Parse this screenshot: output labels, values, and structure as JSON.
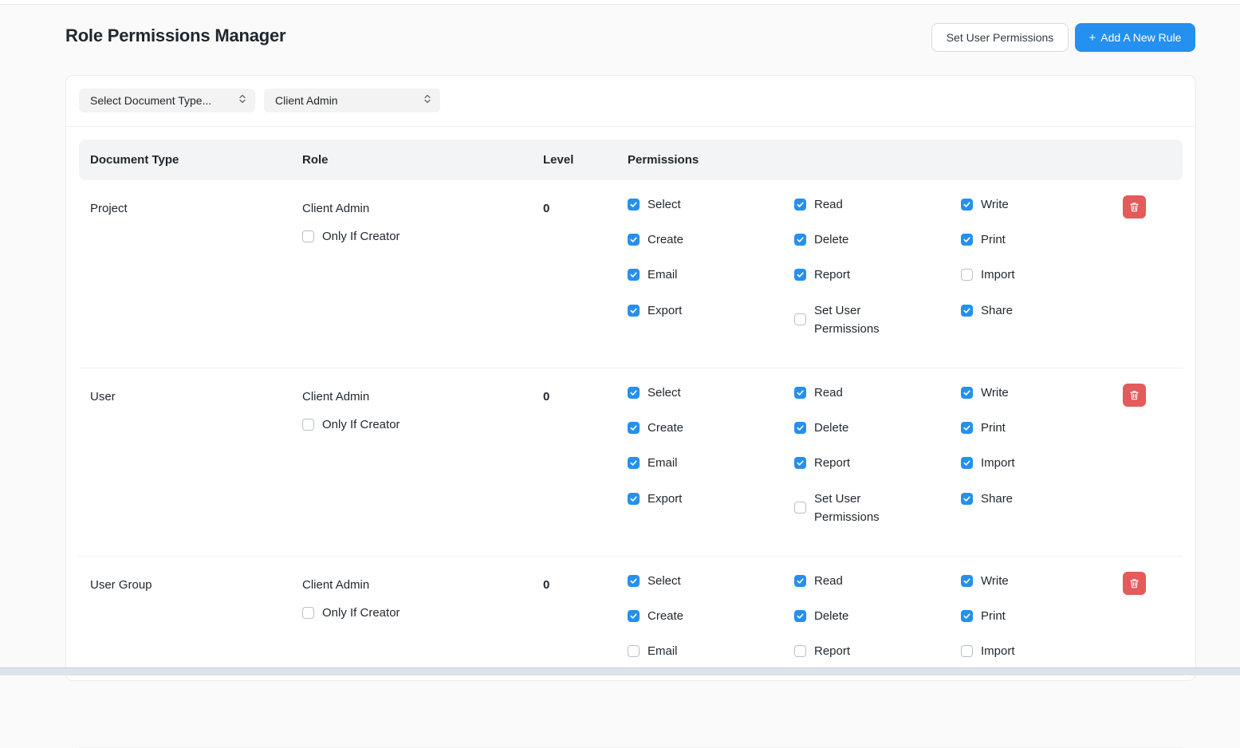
{
  "page": {
    "title": "Role Permissions Manager",
    "set_user_permissions_button": "Set User Permissions",
    "add_rule_button": "Add A New Rule",
    "add_rule_icon": "+"
  },
  "filters": {
    "document_type": "Select Document Type...",
    "role": "Client Admin"
  },
  "table": {
    "headers": {
      "document_type": "Document Type",
      "role": "Role",
      "level": "Level",
      "permissions": "Permissions"
    },
    "rows": [
      {
        "document_type": "Project",
        "role": "Client Admin",
        "only_if_creator_label": "Only If Creator",
        "only_if_creator": false,
        "level": "0",
        "permissions": [
          {
            "label": "Select",
            "checked": true
          },
          {
            "label": "Read",
            "checked": true
          },
          {
            "label": "Write",
            "checked": true
          },
          {
            "label": "Create",
            "checked": true
          },
          {
            "label": "Delete",
            "checked": true
          },
          {
            "label": "Print",
            "checked": true
          },
          {
            "label": "Email",
            "checked": true
          },
          {
            "label": "Report",
            "checked": true
          },
          {
            "label": "Import",
            "checked": false
          },
          {
            "label": "Export",
            "checked": true
          },
          {
            "label": "Set User Permissions",
            "checked": false
          },
          {
            "label": "Share",
            "checked": true
          }
        ]
      },
      {
        "document_type": "User",
        "role": "Client Admin",
        "only_if_creator_label": "Only If Creator",
        "only_if_creator": false,
        "level": "0",
        "permissions": [
          {
            "label": "Select",
            "checked": true
          },
          {
            "label": "Read",
            "checked": true
          },
          {
            "label": "Write",
            "checked": true
          },
          {
            "label": "Create",
            "checked": true
          },
          {
            "label": "Delete",
            "checked": true
          },
          {
            "label": "Print",
            "checked": true
          },
          {
            "label": "Email",
            "checked": true
          },
          {
            "label": "Report",
            "checked": true
          },
          {
            "label": "Import",
            "checked": true
          },
          {
            "label": "Export",
            "checked": true
          },
          {
            "label": "Set User Permissions",
            "checked": false
          },
          {
            "label": "Share",
            "checked": true
          }
        ]
      },
      {
        "document_type": "User Group",
        "role": "Client Admin",
        "only_if_creator_label": "Only If Creator",
        "only_if_creator": false,
        "level": "0",
        "permissions": [
          {
            "label": "Select",
            "checked": true
          },
          {
            "label": "Read",
            "checked": true
          },
          {
            "label": "Write",
            "checked": true
          },
          {
            "label": "Create",
            "checked": true
          },
          {
            "label": "Delete",
            "checked": true
          },
          {
            "label": "Print",
            "checked": true
          },
          {
            "label": "Email",
            "checked": false
          },
          {
            "label": "Report",
            "checked": false
          },
          {
            "label": "Import",
            "checked": false
          }
        ]
      }
    ]
  },
  "icons": {
    "checkbox_checked": "check-icon",
    "delete": "trash-icon",
    "select_chevron": "chevron-up-down-icon"
  },
  "colors": {
    "primary": "#2490ef",
    "danger": "#e35b5b"
  }
}
